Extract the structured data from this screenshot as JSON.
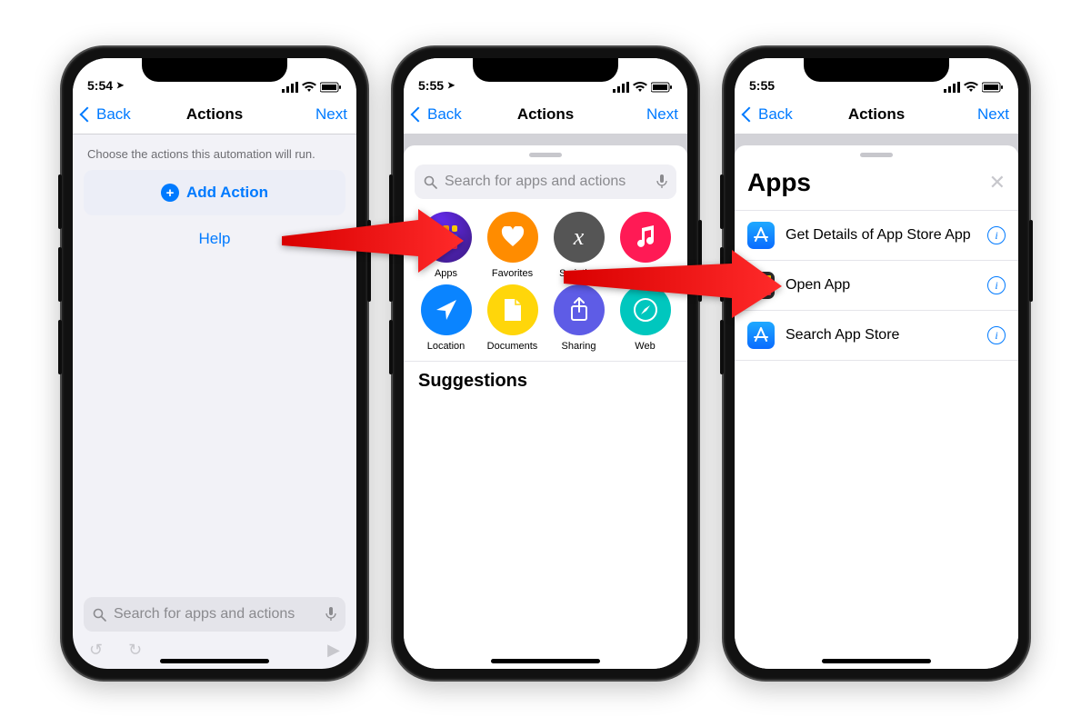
{
  "screen1": {
    "time": "5:54",
    "nav": {
      "back": "Back",
      "title": "Actions",
      "next": "Next"
    },
    "prompt": "Choose the actions this automation will run.",
    "add_action": "Add Action",
    "help": "Help",
    "search_placeholder": "Search for apps and actions"
  },
  "screen2": {
    "time": "5:55",
    "nav": {
      "back": "Back",
      "title": "Actions",
      "next": "Next"
    },
    "search_placeholder": "Search for apps and actions",
    "categories": [
      {
        "label": "Apps"
      },
      {
        "label": "Favorites"
      },
      {
        "label": "Scripting"
      },
      {
        "label": "Media"
      },
      {
        "label": "Location"
      },
      {
        "label": "Documents"
      },
      {
        "label": "Sharing"
      },
      {
        "label": "Web"
      }
    ],
    "suggestions": "Suggestions"
  },
  "screen3": {
    "time": "5:55",
    "nav": {
      "back": "Back",
      "title": "Actions",
      "next": "Next"
    },
    "sheet_title": "Apps",
    "items": [
      {
        "label": "Get Details of App Store App"
      },
      {
        "label": "Open App"
      },
      {
        "label": "Search App Store"
      }
    ]
  },
  "colors": {
    "tint": "#007aff"
  }
}
